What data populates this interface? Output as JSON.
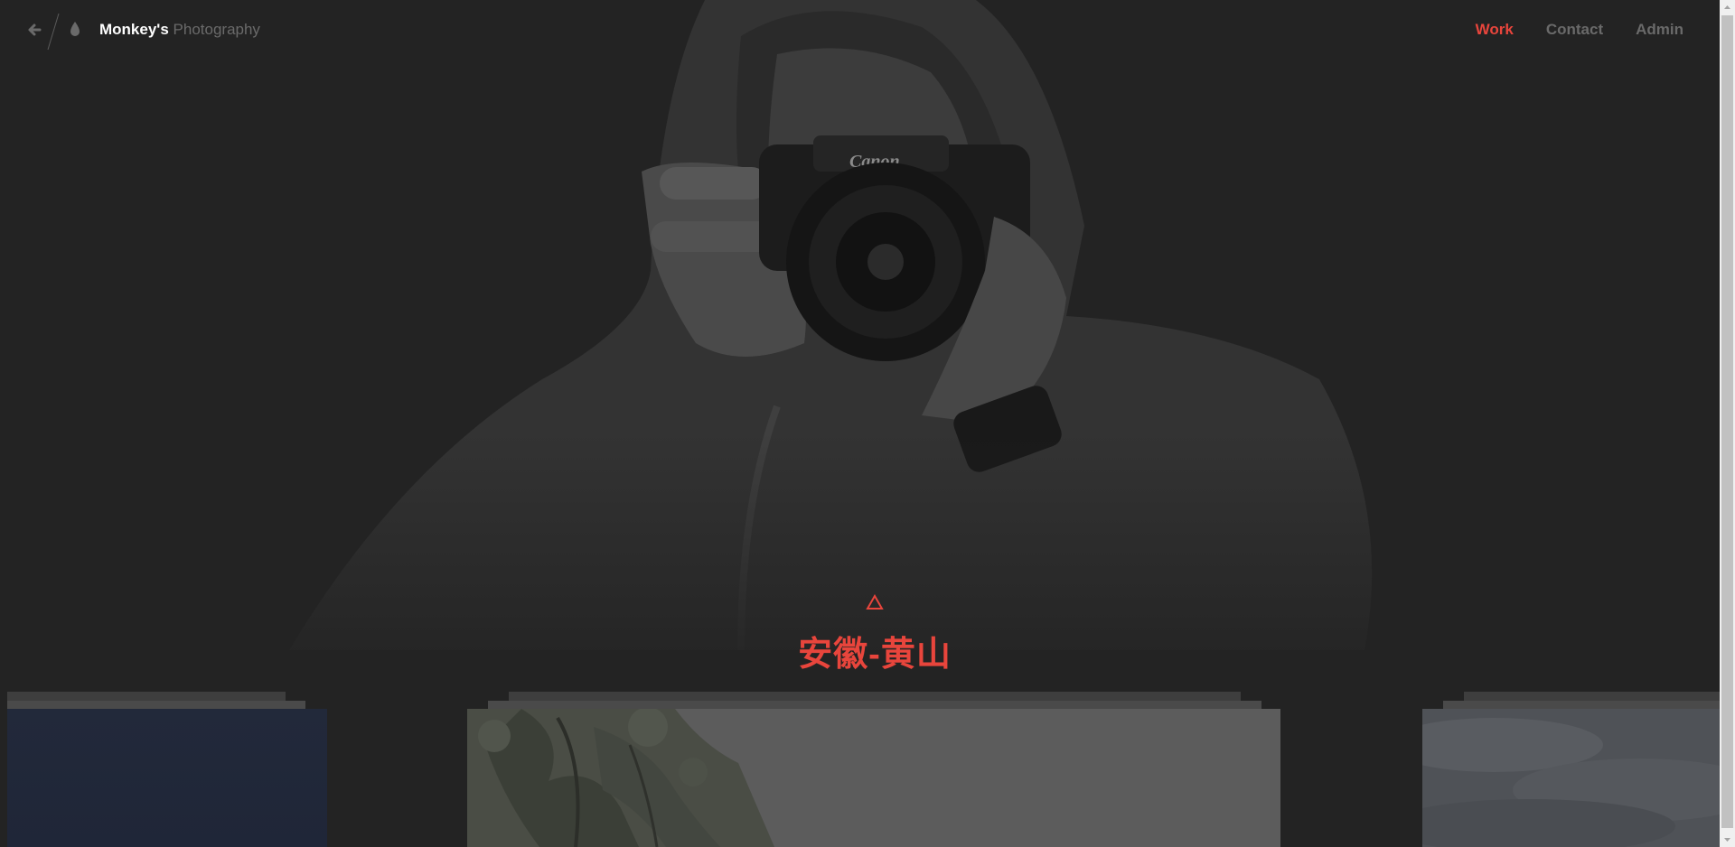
{
  "header": {
    "brand_main": "Monkey's",
    "brand_sub": "Photography",
    "nav": [
      {
        "label": "Work",
        "active": true
      },
      {
        "label": "Contact",
        "active": false
      },
      {
        "label": "Admin",
        "active": false
      }
    ]
  },
  "hero": {
    "camera_brand": "Canon",
    "marker_icon": "triangle-outline-icon",
    "title": "安徽-黄山"
  },
  "icons": {
    "back": "arrow-left-icon",
    "drop": "water-drop-icon"
  },
  "colors": {
    "background": "#232323",
    "accent": "#e8453c",
    "muted_text": "#6a6a6a",
    "white": "#ffffff"
  }
}
